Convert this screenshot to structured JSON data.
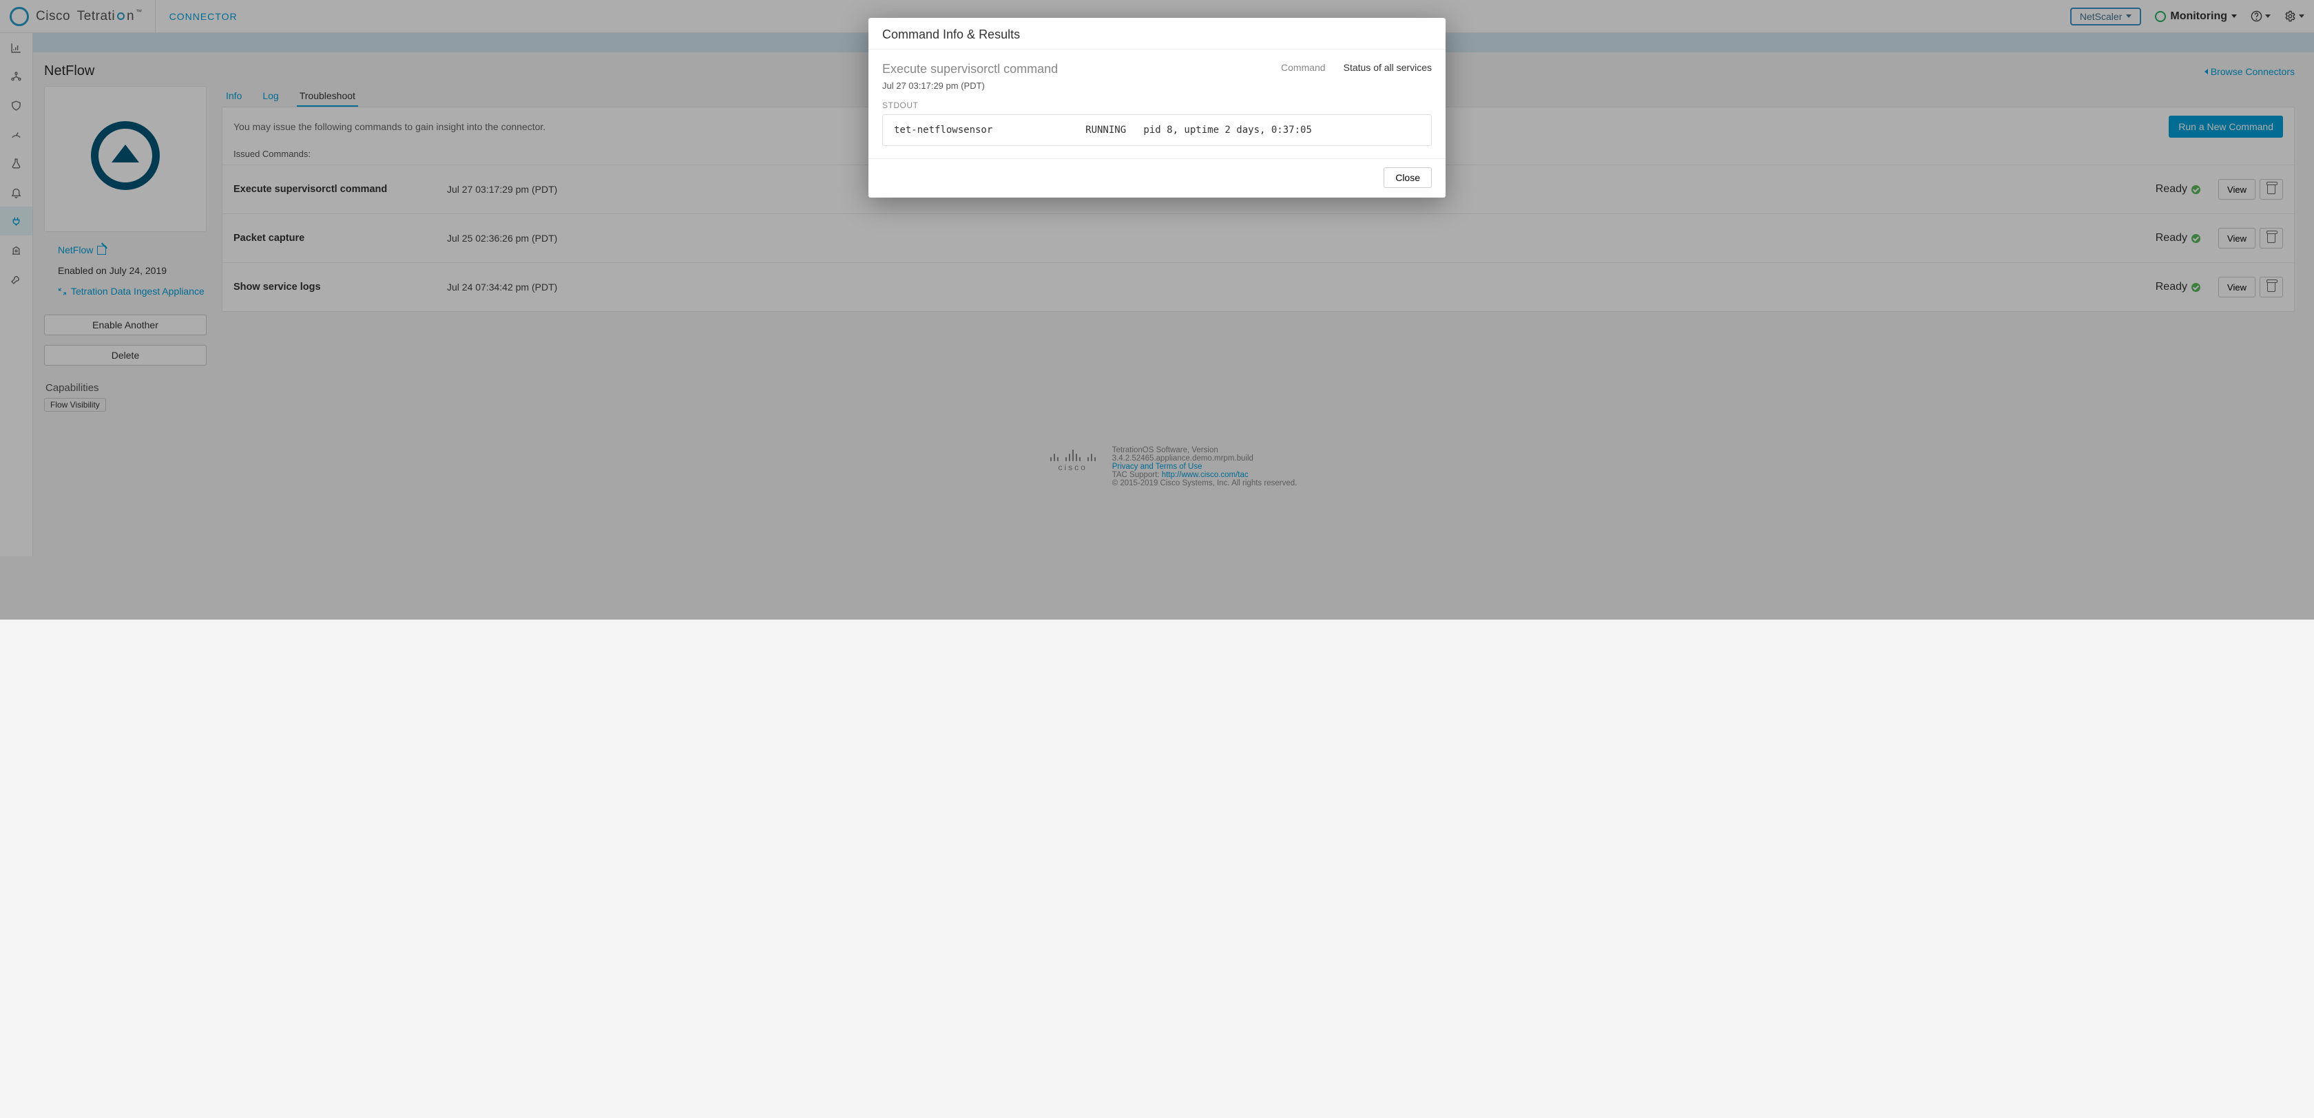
{
  "header": {
    "brand_prefix": "Cisco",
    "brand_name": "Tetrati",
    "brand_accent": "⬤",
    "brand_suffix": "n",
    "trademark": "™",
    "connector_label": "CONNECTOR",
    "scope_label": "NetScaler",
    "monitoring_label": "Monitoring"
  },
  "page": {
    "title": "NetFlow",
    "browse_link": "Browse Connectors"
  },
  "side": {
    "name": "NetFlow",
    "enabled_on": "Enabled on July 24, 2019",
    "ingest_link": "Tetration Data Ingest Appliance",
    "enable_btn": "Enable Another",
    "delete_btn": "Delete",
    "cap_header": "Capabilities",
    "cap_tag": "Flow Visibility"
  },
  "tabs": {
    "info": "Info",
    "log": "Log",
    "troubleshoot": "Troubleshoot"
  },
  "panel": {
    "hint": "You may issue the following commands to gain insight into the connector.",
    "run_btn": "Run a New Command",
    "issued_header": "Issued Commands:",
    "view_label": "View",
    "ready_label": "Ready",
    "rows": [
      {
        "name": "Execute supervisorctl command",
        "time": "Jul 27 03:17:29 pm (PDT)"
      },
      {
        "name": "Packet capture",
        "time": "Jul 25 02:36:26 pm (PDT)"
      },
      {
        "name": "Show service logs",
        "time": "Jul 24 07:34:42 pm (PDT)"
      }
    ]
  },
  "footer": {
    "l1": "TetrationOS Software, Version",
    "l2": "3.4.2.52465.appliance.demo.mrpm.build",
    "privacy": "Privacy and Terms of Use",
    "tac_prefix": "TAC Support: ",
    "tac_link": "http://www.cisco.com/tac",
    "copyright": "© 2015-2019 Cisco Systems, Inc. All rights reserved.",
    "cisco_word": "cisco"
  },
  "modal": {
    "title": "Command Info & Results",
    "cmd_title": "Execute supervisorctl command",
    "timestamp": "Jul 27 03:17:29 pm (PDT)",
    "tab_command": "Command",
    "tab_status": "Status of all services",
    "stdout_label": "STDOUT",
    "stdout": "tet-netflowsensor                RUNNING   pid 8, uptime 2 days, 0:37:05",
    "close": "Close"
  }
}
